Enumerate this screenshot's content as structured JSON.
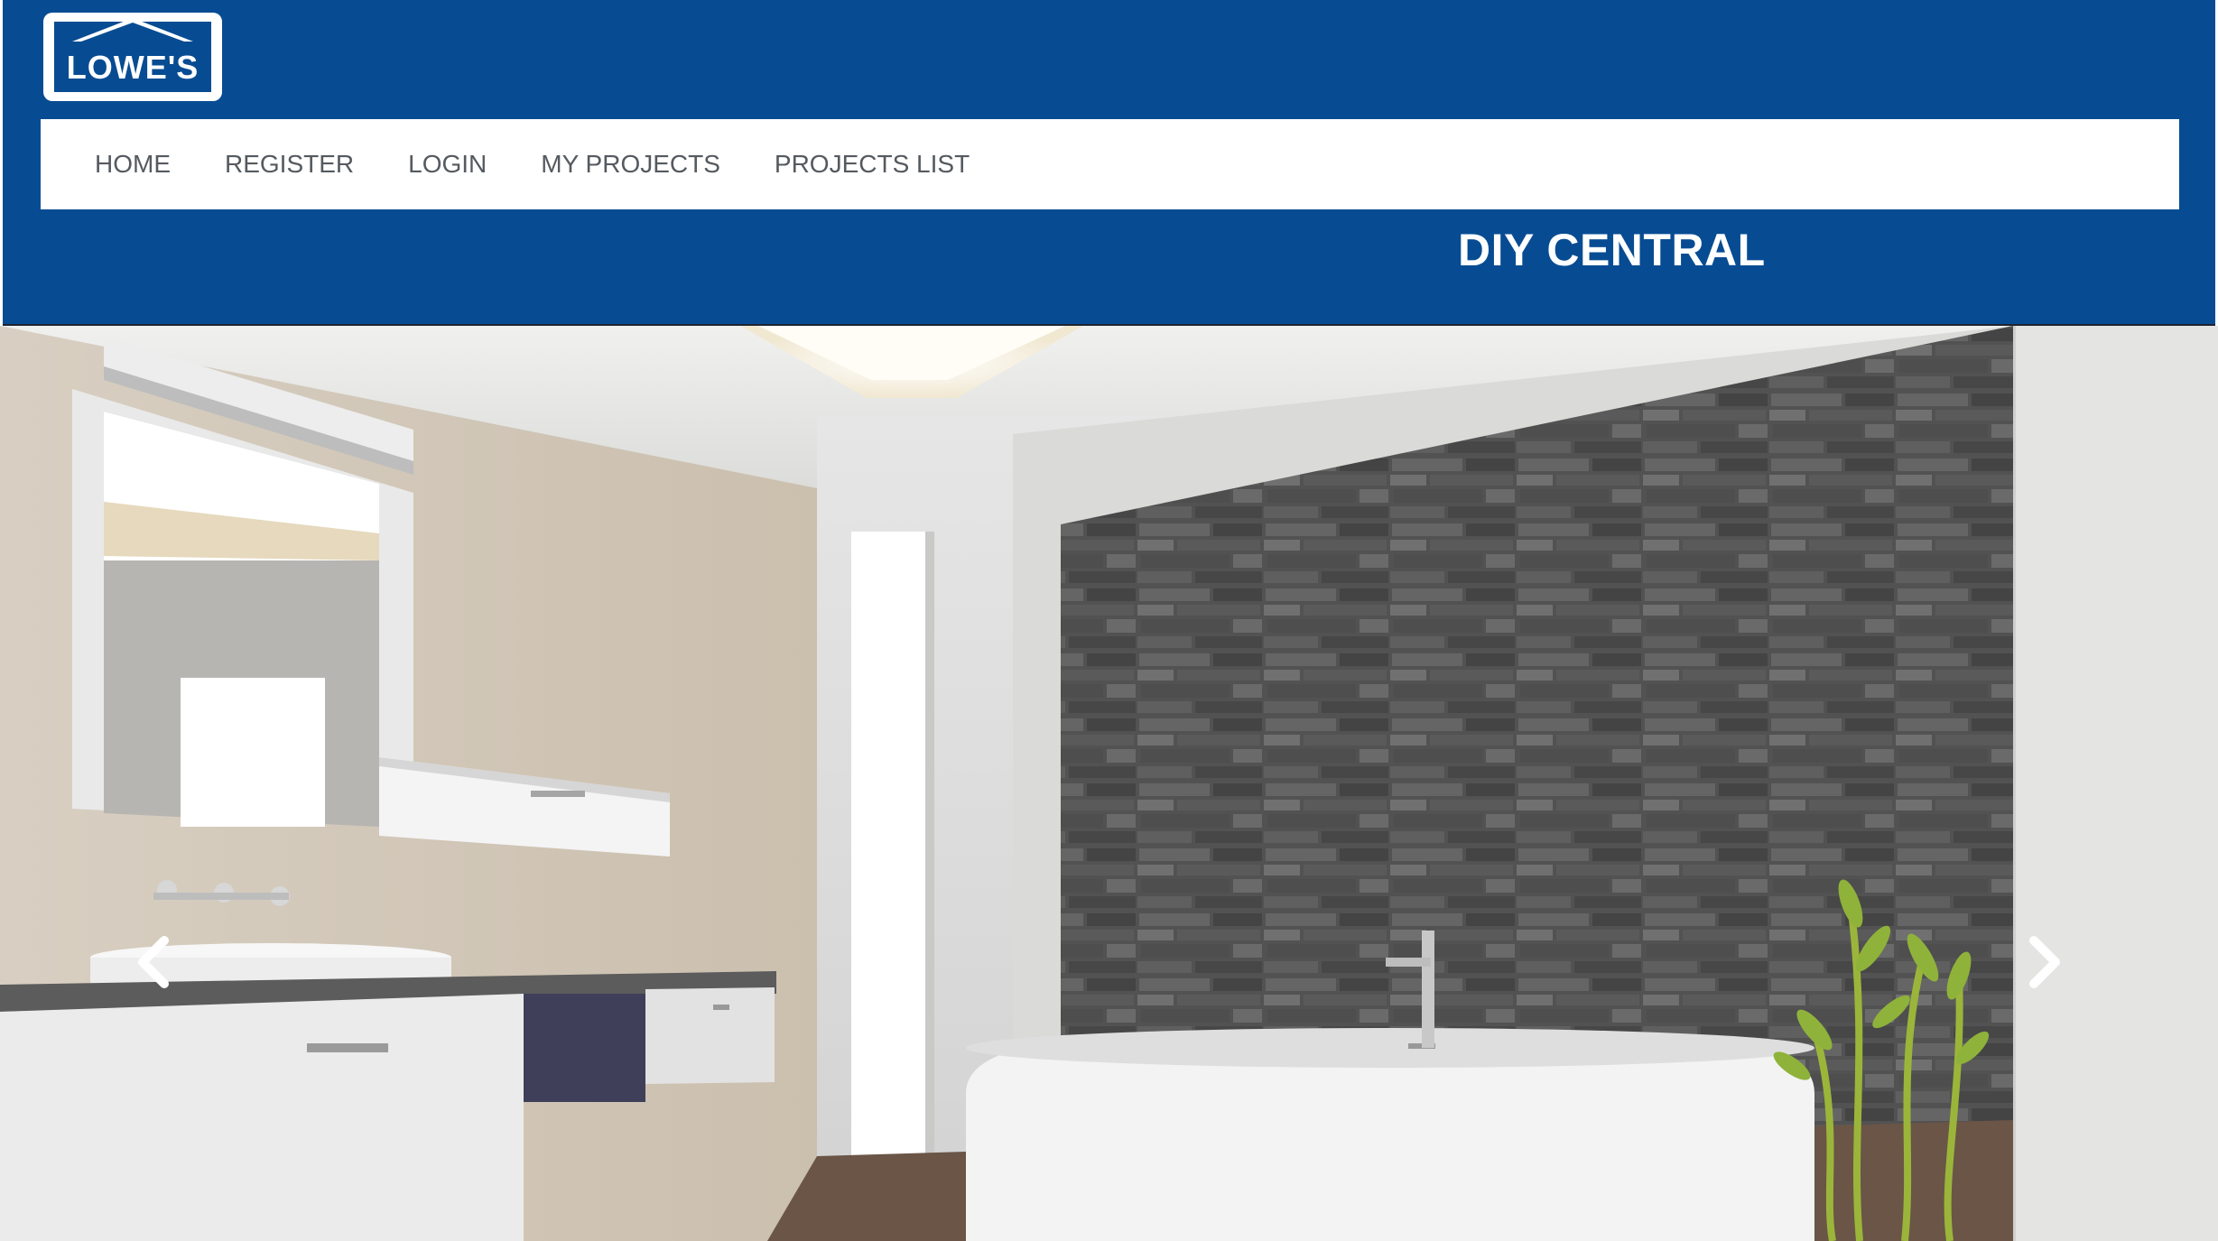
{
  "header": {
    "logo_text": "LOWE'S",
    "site_title": "DIY CENTRAL",
    "brand_color": "#074c93"
  },
  "nav": {
    "items": [
      {
        "label": "HOME"
      },
      {
        "label": "REGISTER"
      },
      {
        "label": "LOGIN"
      },
      {
        "label": "MY PROJECTS"
      },
      {
        "label": "PROJECTS LIST"
      }
    ]
  },
  "carousel": {
    "prev_icon": "chevron-left-icon",
    "next_icon": "chevron-right-icon"
  }
}
